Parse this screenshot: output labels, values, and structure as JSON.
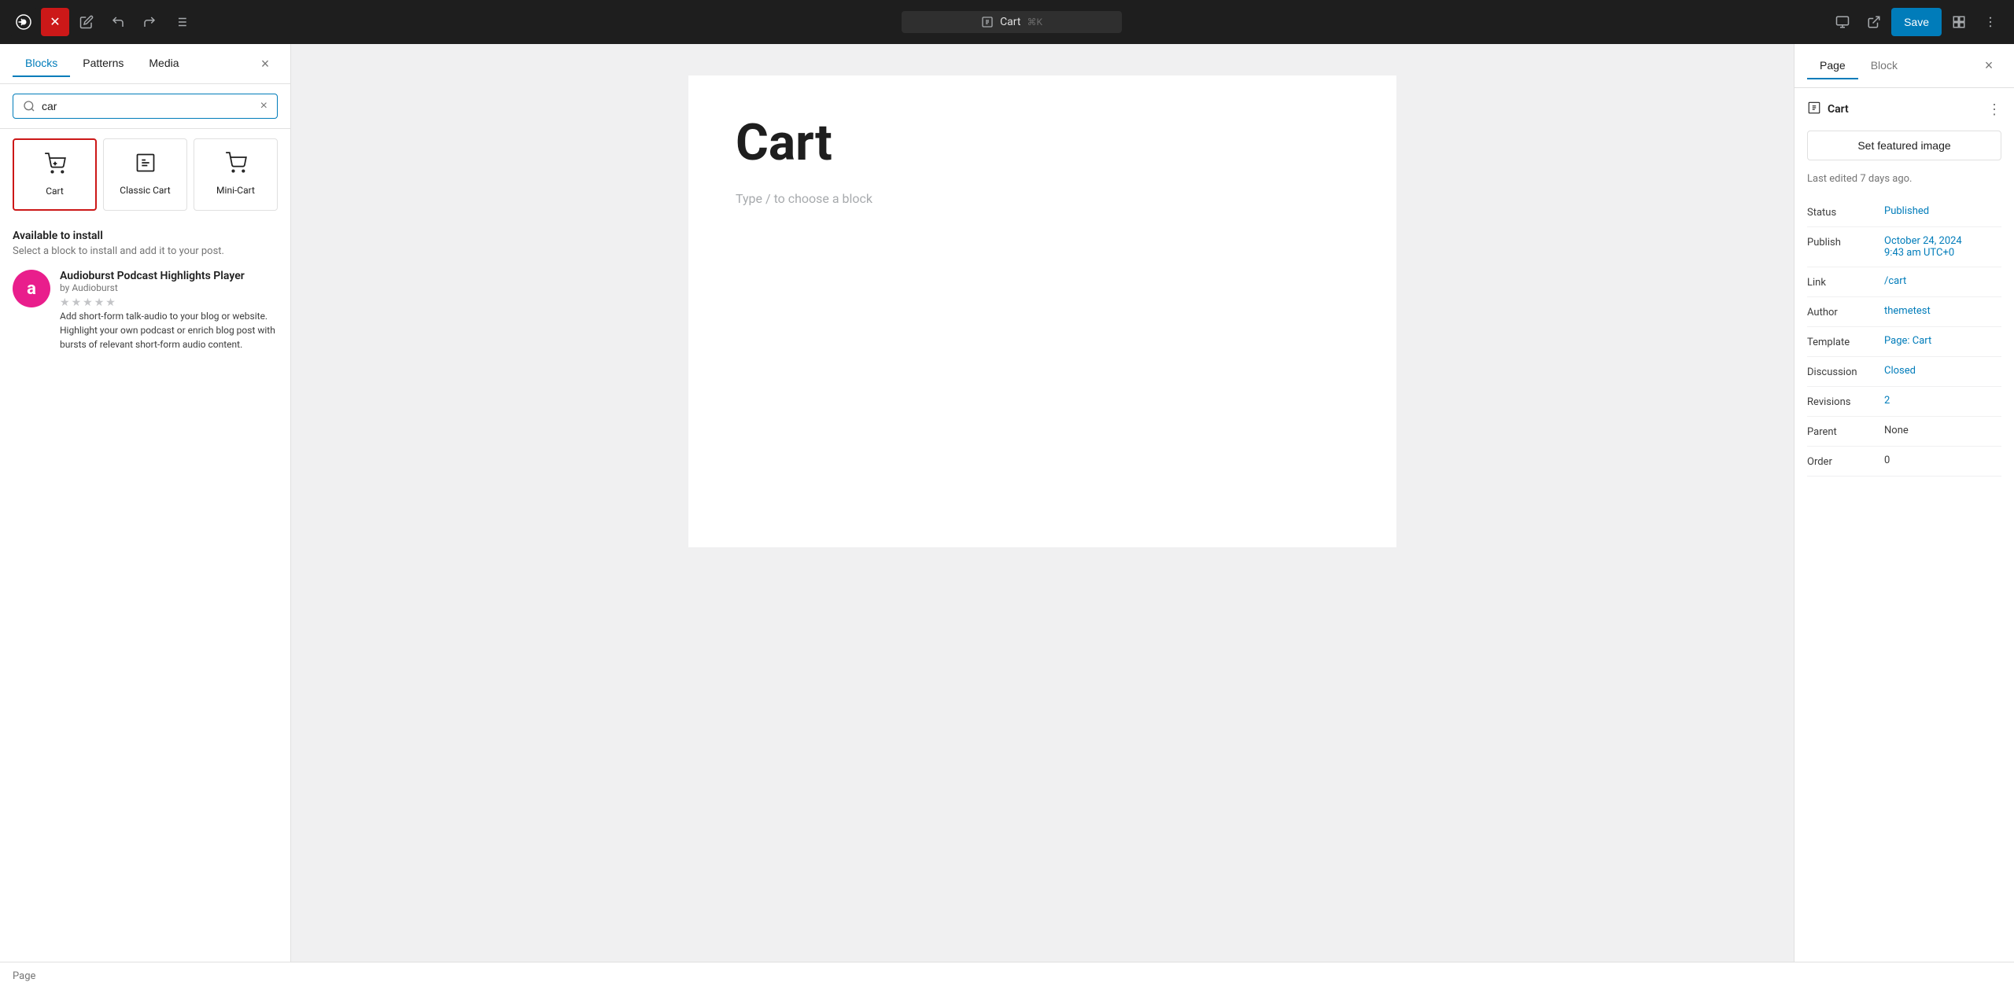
{
  "toolbar": {
    "wp_logo": "W",
    "close_label": "✕",
    "edit_icon": "✏",
    "undo_icon": "↩",
    "redo_icon": "↪",
    "list_icon": "≡",
    "page_title": "Cart",
    "keyboard_shortcut": "⌘K",
    "view_icon": "⊡",
    "external_icon": "⎋",
    "save_label": "Save",
    "settings_icon": "⊟",
    "more_icon": "⋮"
  },
  "inserter": {
    "tabs": [
      {
        "id": "blocks",
        "label": "Blocks",
        "active": true
      },
      {
        "id": "patterns",
        "label": "Patterns",
        "active": false
      },
      {
        "id": "media",
        "label": "Media",
        "active": false
      }
    ],
    "close_label": "×",
    "search": {
      "value": "car",
      "placeholder": "Search"
    },
    "blocks": [
      {
        "id": "cart",
        "label": "Cart",
        "selected": true
      },
      {
        "id": "classic-cart",
        "label": "Classic Cart",
        "selected": false
      },
      {
        "id": "mini-cart",
        "label": "Mini-Cart",
        "selected": false
      }
    ],
    "available_section": {
      "title": "Available to install",
      "subtitle": "Select a block to install and add it to your post."
    },
    "plugin": {
      "icon_letter": "a",
      "name": "Audioburst Podcast Highlights Player",
      "by": "by Audioburst",
      "description": "Add short-form talk-audio to your blog or website. Highlight your own podcast or enrich blog post with bursts of relevant short-form audio content.",
      "stars": [
        false,
        false,
        false,
        false,
        false
      ]
    }
  },
  "editor": {
    "page_title": "Cart",
    "placeholder": "Type / to choose a block"
  },
  "right_sidebar": {
    "tabs": [
      {
        "id": "page",
        "label": "Page",
        "active": true
      },
      {
        "id": "block",
        "label": "Block",
        "active": false
      }
    ],
    "block_header": {
      "title": "Cart",
      "more_icon": "⋮"
    },
    "featured_image_btn": "Set featured image",
    "last_edited": "Last edited 7 days ago.",
    "meta": [
      {
        "label": "Status",
        "value": "Published",
        "link": true
      },
      {
        "label": "Publish",
        "value": "October 24, 2024\n9:43 am UTC+0",
        "link": true
      },
      {
        "label": "Link",
        "value": "/cart",
        "link": true
      },
      {
        "label": "Author",
        "value": "themetest",
        "link": true
      },
      {
        "label": "Template",
        "value": "Page: Cart",
        "link": true
      },
      {
        "label": "Discussion",
        "value": "Closed",
        "link": true
      },
      {
        "label": "Revisions",
        "value": "2",
        "link": true
      },
      {
        "label": "Parent",
        "value": "None",
        "link": false
      },
      {
        "label": "Order",
        "value": "0",
        "link": false
      }
    ]
  },
  "bottom_bar": {
    "label": "Page"
  },
  "colors": {
    "accent": "#007cba",
    "danger": "#cc1818",
    "toolbar_bg": "#1e1e1e"
  }
}
